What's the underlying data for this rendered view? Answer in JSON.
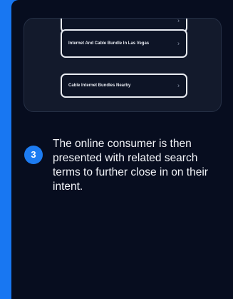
{
  "search_preview": {
    "terms": [
      {
        "label": "",
        "chevron": "›"
      },
      {
        "label": "Internet And Cable Bundle In Las Vegas",
        "chevron": "›"
      },
      {
        "label": "Cable Internet Bundles Nearby",
        "chevron": "›"
      }
    ]
  },
  "step": {
    "number": "3",
    "text": "The online consumer is then presented with related search terms to further close in on their intent."
  },
  "colors": {
    "page_background": "#1877f2",
    "card_background": "#070d1f",
    "badge": "#1d7cf2"
  }
}
